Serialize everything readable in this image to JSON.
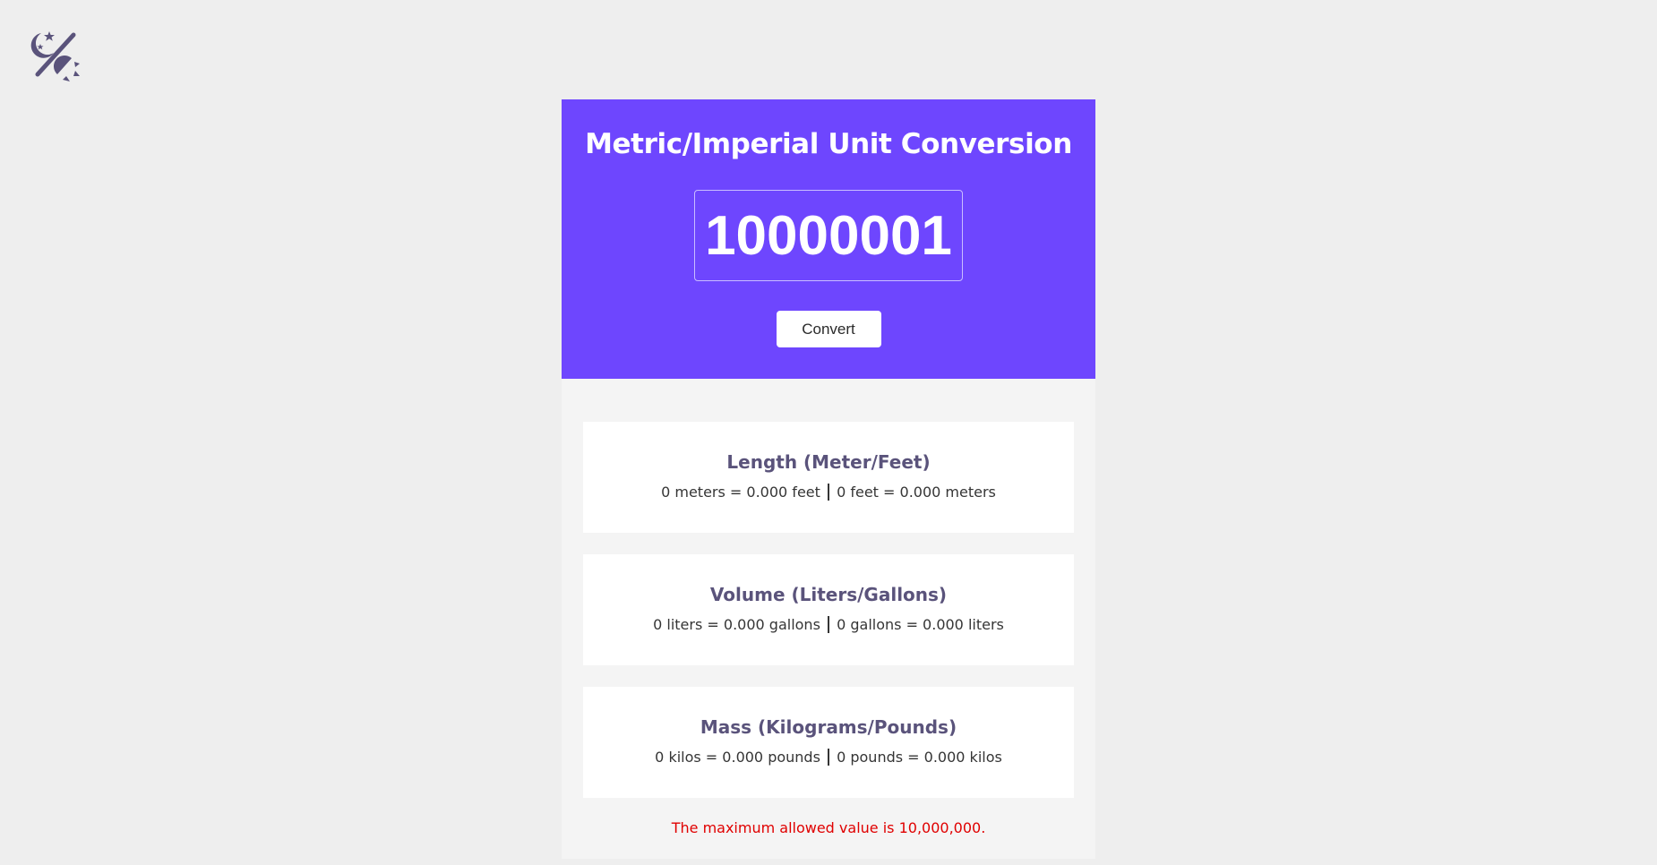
{
  "header": {
    "theme_toggle_icon": "moon-sun-toggle-icon",
    "icon_color": "#5a537b"
  },
  "hero": {
    "title": "Metric/Imperial Unit Conversion",
    "input_value": "10000001",
    "convert_label": "Convert",
    "background": "#6e46fe"
  },
  "results": [
    {
      "title": "Length (Meter/Feet)",
      "left": "0 meters = 0.000 feet",
      "right": "0 feet = 0.000 meters"
    },
    {
      "title": "Volume (Liters/Gallons)",
      "left": "0 liters = 0.000 gallons",
      "right": "0 gallons = 0.000 liters"
    },
    {
      "title": "Mass (Kilograms/Pounds)",
      "left": "0 kilos = 0.000 pounds",
      "right": "0 pounds = 0.000 kilos"
    }
  ],
  "error": {
    "message": "The maximum allowed value is 10,000,000.",
    "color": "#e00000"
  }
}
